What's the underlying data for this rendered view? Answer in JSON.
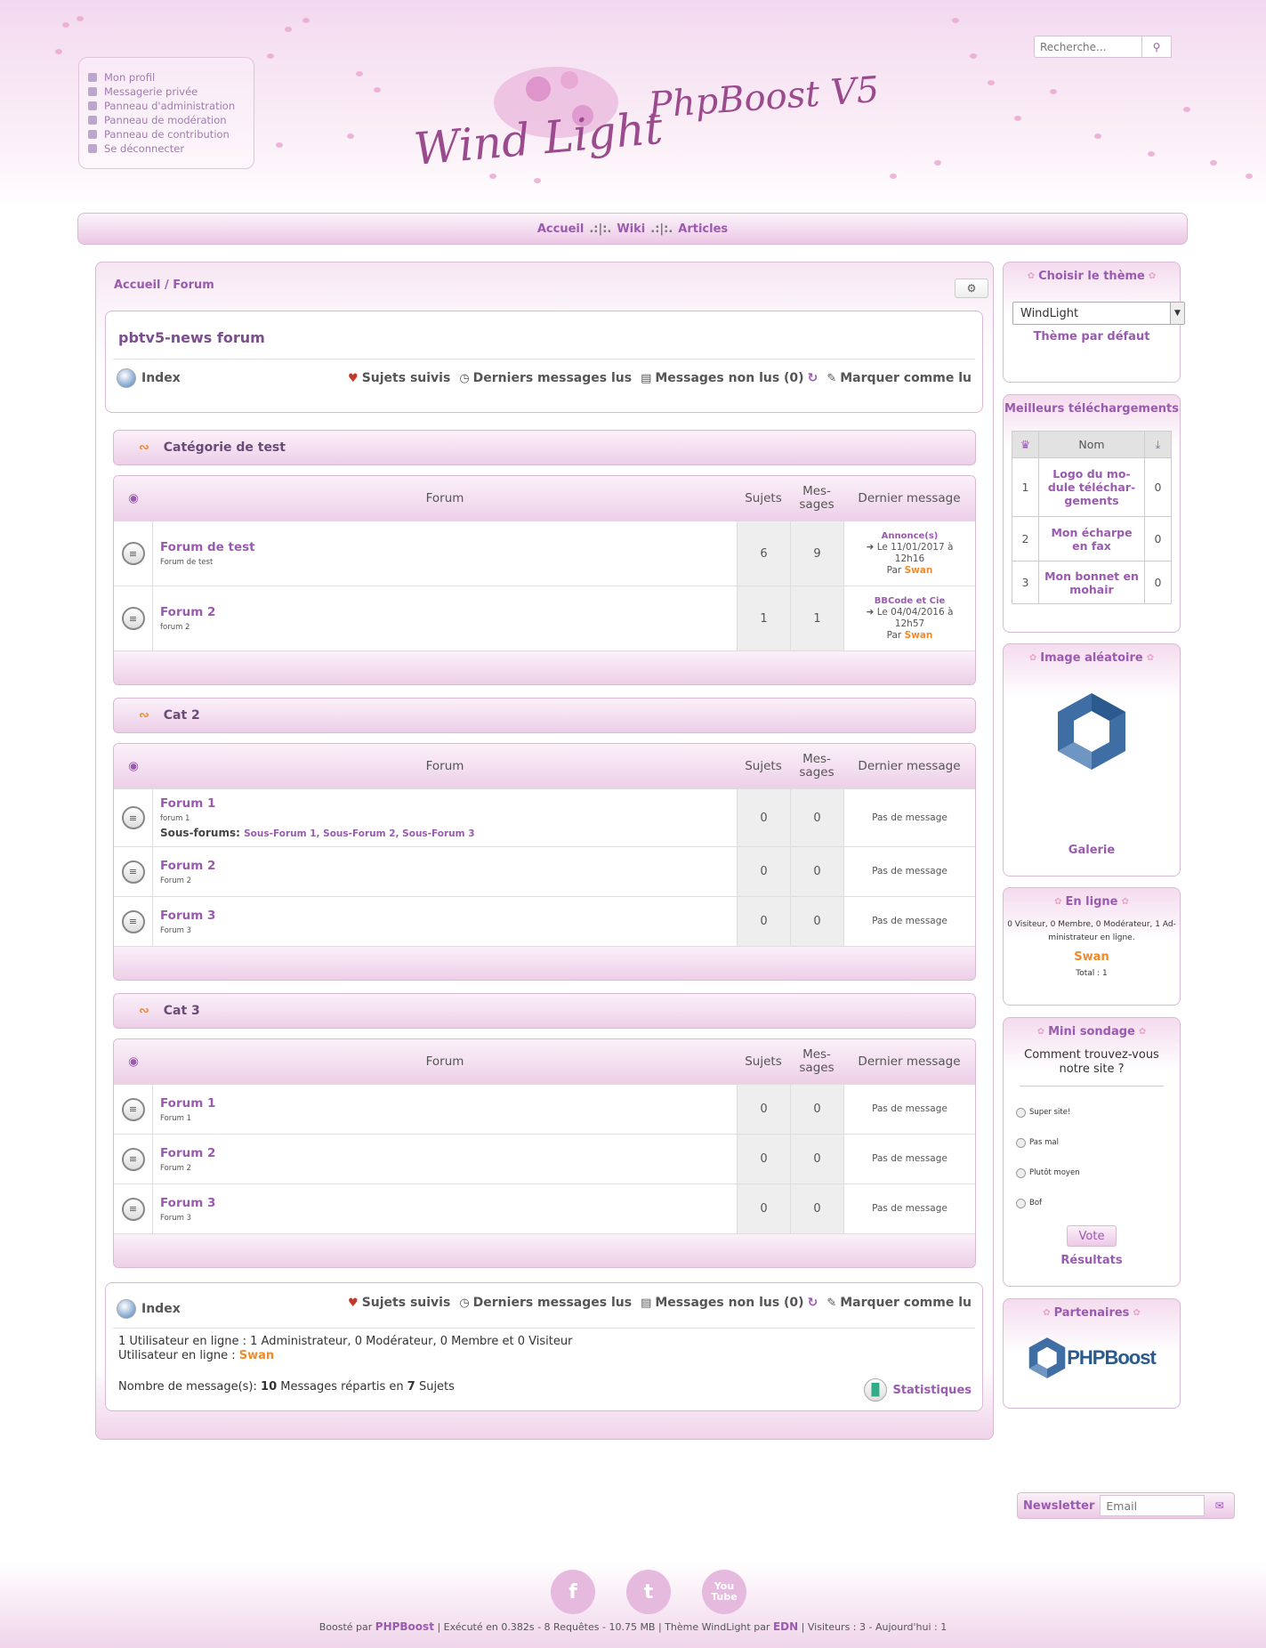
{
  "user_menu": [
    "Mon profil",
    "Messagerie privée",
    "Panneau d'administration",
    "Panneau de modération",
    "Panneau de contribution",
    "Se déconnecter"
  ],
  "logo": {
    "line1": "Wind Light",
    "line2": "PhpBoost V5"
  },
  "search": {
    "placeholder": "Recherche...",
    "icon": "search-icon"
  },
  "nav": {
    "items": [
      "Accueil",
      "Wiki",
      "Articles"
    ],
    "separator": ".:|:."
  },
  "breadcrumb": {
    "home": "Accueil",
    "separator": " / ",
    "current": "Forum"
  },
  "forum": {
    "title": "pbtv5-news forum",
    "index_label": "Index",
    "actions": {
      "followed": "Sujets suivis",
      "last_read": "Derniers messages lus",
      "unread": "Messages non lus (0)",
      "mark_read": "Marquer comme lu"
    }
  },
  "table_headers": {
    "forum": "Forum",
    "topics": "Sujets",
    "messages_line1": "Mes-",
    "messages_line2": "sages",
    "last_message": "Dernier message"
  },
  "categories": [
    {
      "name": "Catégorie de test",
      "forums": [
        {
          "title": "Forum de test",
          "desc": "Forum de test",
          "topics": "6",
          "messages": "9",
          "last_topic": "Annonce(s)",
          "last_date_line1": "Le 11/01/2017 à",
          "last_date_line2": "12h16",
          "by": "Par",
          "author": "Swan"
        },
        {
          "title": "Forum 2",
          "desc": "forum 2",
          "topics": "1",
          "messages": "1",
          "last_topic": "BBCode et Cie",
          "last_date_line1": "Le 04/04/2016 à",
          "last_date_line2": "12h57",
          "by": "Par",
          "author": "Swan"
        }
      ]
    },
    {
      "name": "Cat 2",
      "forums": [
        {
          "title": "Forum 1",
          "desc": "forum 1",
          "subforums_label": "Sous-forums:",
          "subforums": "Sous-Forum 1, Sous-Forum 2, Sous-Forum 3",
          "topics": "0",
          "messages": "0",
          "no_message": "Pas de message"
        },
        {
          "title": "Forum 2",
          "desc": "Forum 2",
          "topics": "0",
          "messages": "0",
          "no_message": "Pas de message"
        },
        {
          "title": "Forum 3",
          "desc": "Forum 3",
          "topics": "0",
          "messages": "0",
          "no_message": "Pas de message"
        }
      ]
    },
    {
      "name": "Cat 3",
      "forums": [
        {
          "title": "Forum 1",
          "desc": "Forum 1",
          "topics": "0",
          "messages": "0",
          "no_message": "Pas de message"
        },
        {
          "title": "Forum 2",
          "desc": "Forum 2",
          "topics": "0",
          "messages": "0",
          "no_message": "Pas de message"
        },
        {
          "title": "Forum 3",
          "desc": "Forum 3",
          "topics": "0",
          "messages": "0",
          "no_message": "Pas de message"
        }
      ]
    }
  ],
  "stats": {
    "online_line": "1 Utilisateur en ligne : 1 Administrateur, 0 Modérateur, 0 Membre et 0 Visiteur",
    "online_users_label": "Utilisateur en ligne :",
    "online_user": "Swan",
    "msg_prefix": "Nombre de message(s):",
    "msg_count": "10",
    "msg_mid": "Messages répartis en",
    "topic_count": "7",
    "msg_suffix": "Sujets",
    "stats_link": "Statistiques"
  },
  "sidebar": {
    "theme": {
      "title": "Choisir le thème",
      "selected": "WindLight",
      "default_link": "Thème par défaut"
    },
    "downloads": {
      "title": "Meilleurs téléchargements",
      "col_name": "Nom",
      "rows": [
        {
          "rank": "1",
          "line1": "Logo du mo-",
          "line2": "dule téléchar-",
          "line3": "gements",
          "count": "0"
        },
        {
          "rank": "2",
          "line1": "Mon écharpe",
          "line2": "en fax",
          "line3": "",
          "count": "0"
        },
        {
          "rank": "3",
          "line1": "Mon bonnet en",
          "line2": "mohair",
          "line3": "",
          "count": "0"
        }
      ]
    },
    "random_image": {
      "title": "Image aléatoire",
      "link": "Galerie"
    },
    "online": {
      "title": "En ligne",
      "line1": "0 Visiteur, 0 Membre, 0 Modérateur, 1 Ad-",
      "line2": "ministrateur en ligne.",
      "user": "Swan",
      "total": "Total : 1"
    },
    "poll": {
      "title": "Mini sondage",
      "question_line1": "Comment trouvez-vous",
      "question_line2": "notre site ?",
      "options": [
        "Super site!",
        "Pas mal",
        "Plutôt moyen",
        "Bof"
      ],
      "vote": "Vote",
      "results": "Résultats"
    },
    "partners": {
      "title": "Partenaires",
      "logo_text": "PHPBoost"
    }
  },
  "newsletter": {
    "label": "Newsletter",
    "placeholder": "Email"
  },
  "footer": {
    "social": [
      "f",
      "t",
      "You Tube"
    ],
    "boosted_by": "Boosté par",
    "phpboost": "PHPBoost",
    "exec": "| Exécuté en 0.382s - 8 Requêtes - 10.75 MB | Thème WindLight par",
    "edn": "EDN",
    "visitors": "| Visiteurs : 3 - Aujourd'hui : 1"
  },
  "colors": {
    "accent": "#9a5ab0",
    "orange": "#f08a2a",
    "pink_bg": "#f3d9ef"
  }
}
